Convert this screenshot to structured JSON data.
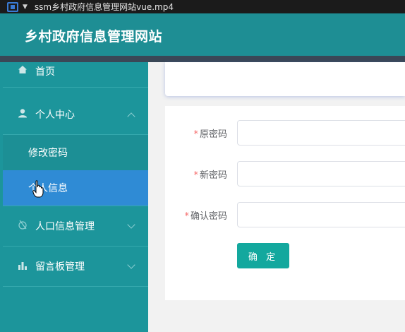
{
  "player": {
    "title": "ssm乡村政府信息管理网站vue.mp4"
  },
  "header": {
    "title": "乡村政府信息管理网站"
  },
  "sidebar": {
    "items": [
      {
        "label": "首页",
        "icon": "home-icon"
      },
      {
        "label": "个人中心",
        "icon": "user-icon",
        "expanded": true,
        "children": [
          {
            "label": "修改密码"
          },
          {
            "label": "个人信息",
            "active": true
          }
        ]
      },
      {
        "label": "人口信息管理",
        "icon": "population-icon"
      },
      {
        "label": "留言板管理",
        "icon": "bar-chart-icon"
      }
    ]
  },
  "form": {
    "fields": [
      {
        "label": "原密码",
        "required": true,
        "value": ""
      },
      {
        "label": "新密码",
        "required": true,
        "value": ""
      },
      {
        "label": "确认密码",
        "required": true,
        "value": ""
      }
    ],
    "submit_label": "确 定"
  },
  "colors": {
    "header": "#1e8e94",
    "sidebar": "#1c959b",
    "active_item": "#2f8bd5",
    "button": "#13a89e",
    "required_star": "#f56c6c"
  }
}
